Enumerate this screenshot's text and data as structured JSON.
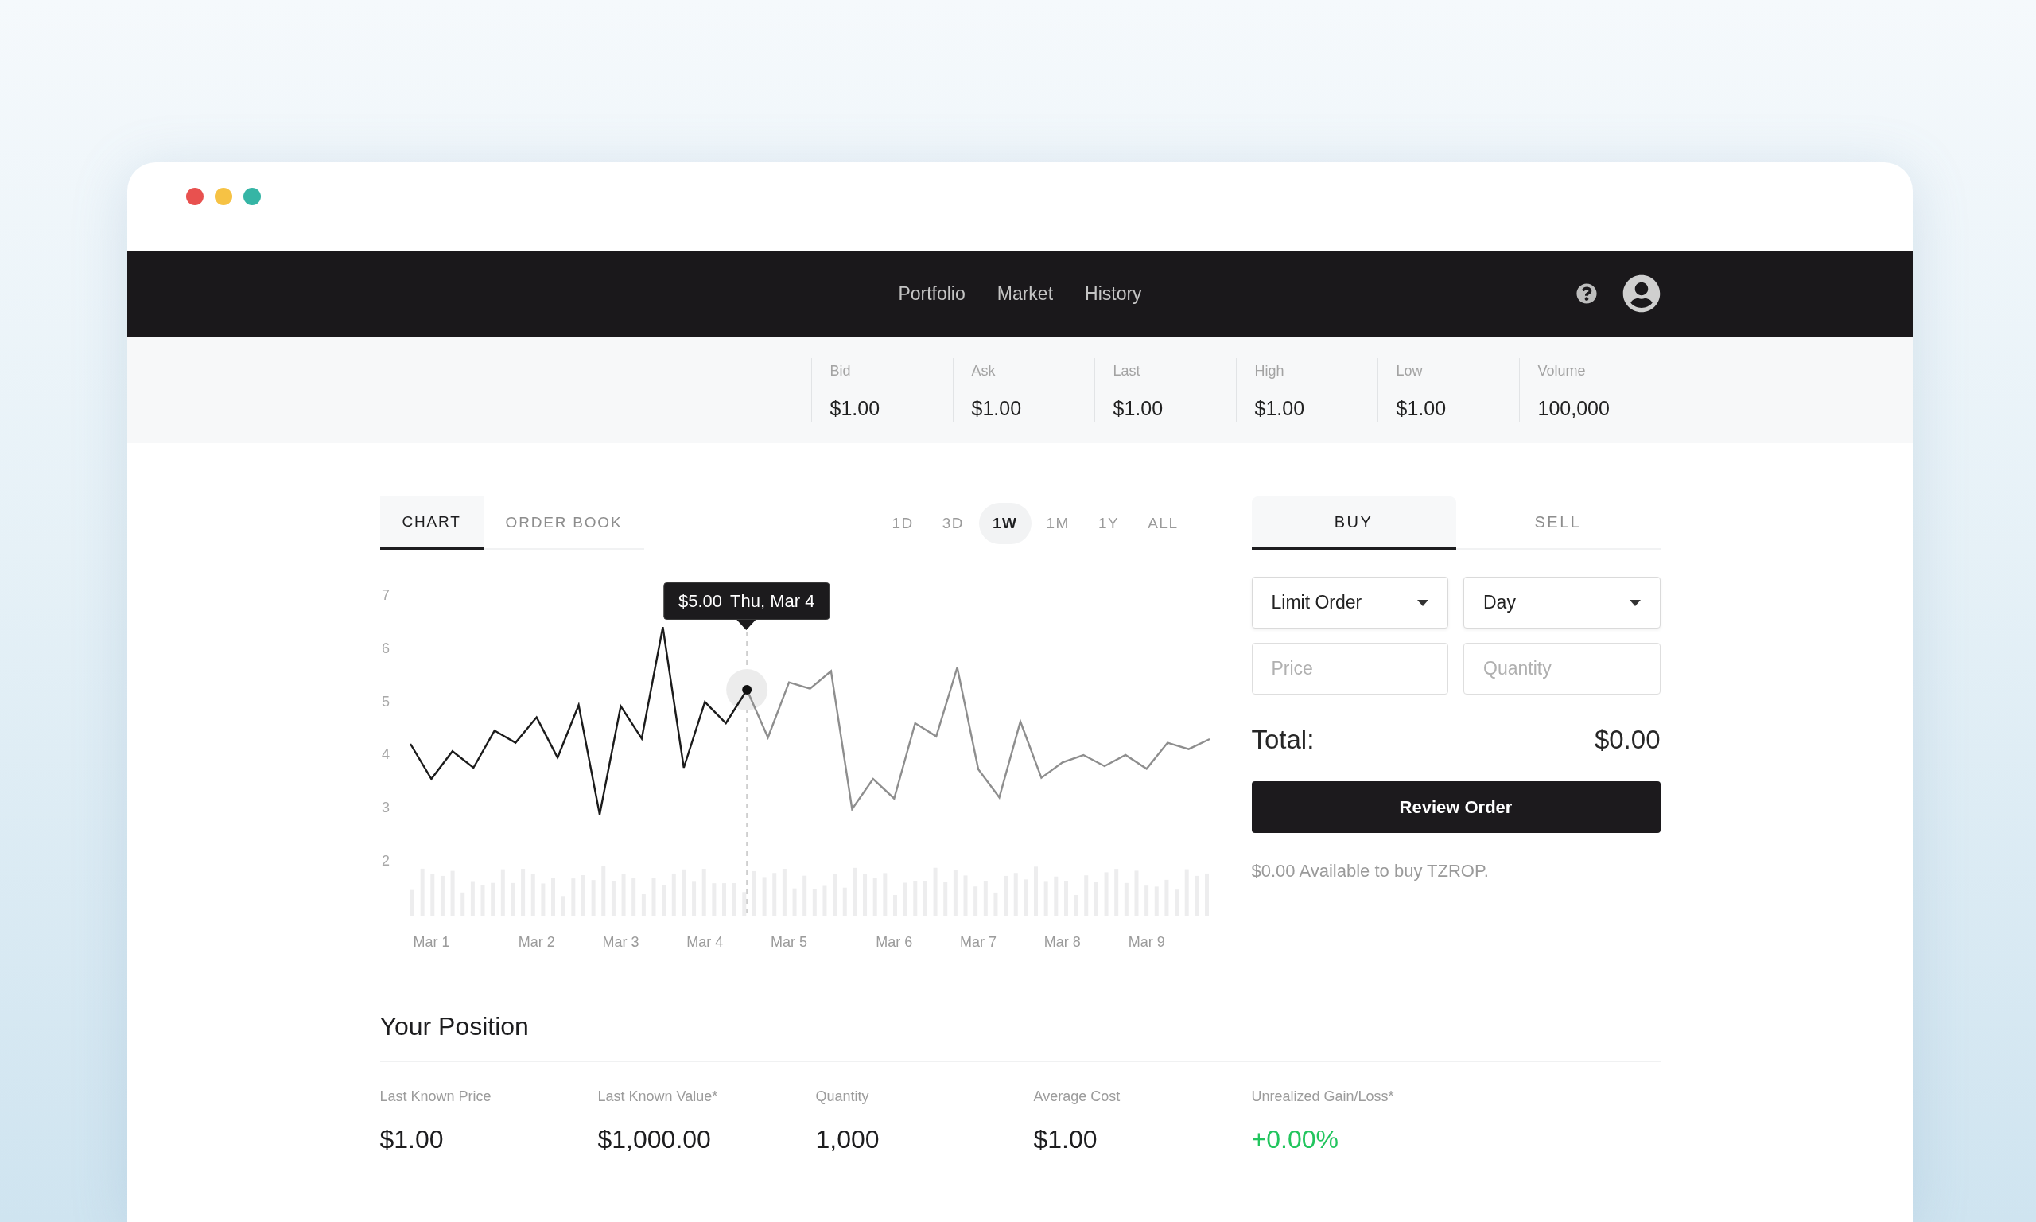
{
  "window": {
    "controls": [
      {
        "color": "#e8514f"
      },
      {
        "color": "#f6c244"
      },
      {
        "color": "#35b5a5"
      }
    ]
  },
  "nav": {
    "links": [
      {
        "label": "Portfolio"
      },
      {
        "label": "Market"
      },
      {
        "label": "History"
      }
    ]
  },
  "quote_stats": [
    {
      "label": "Bid",
      "value": "$1.00"
    },
    {
      "label": "Ask",
      "value": "$1.00"
    },
    {
      "label": "Last",
      "value": "$1.00"
    },
    {
      "label": "High",
      "value": "$1.00"
    },
    {
      "label": "Low",
      "value": "$1.00"
    },
    {
      "label": "Volume",
      "value": "100,000"
    }
  ],
  "chart_panel": {
    "tabs": [
      {
        "label": "CHART",
        "selected": true
      },
      {
        "label": "ORDER BOOK",
        "selected": false
      }
    ],
    "ranges": [
      {
        "label": "1D",
        "selected": false
      },
      {
        "label": "3D",
        "selected": false
      },
      {
        "label": "1W",
        "selected": true
      },
      {
        "label": "1M",
        "selected": false
      },
      {
        "label": "1Y",
        "selected": false
      },
      {
        "label": "ALL",
        "selected": false
      }
    ],
    "tooltip": {
      "value": "$5.00",
      "date": "Thu, Mar 4"
    },
    "chart_data": [
      {
        "type": "line",
        "categories": [
          null,
          "Mar 1",
          null,
          null,
          null,
          null,
          "Mar 2",
          null,
          null,
          null,
          "Mar 3",
          null,
          null,
          null,
          "Mar 4",
          null,
          null,
          null,
          "Mar 5",
          null,
          null,
          null,
          null,
          "Mar 6",
          null,
          null,
          null,
          "Mar 7",
          null,
          null,
          null,
          "Mar 8",
          null,
          null,
          null,
          "Mar 9",
          null,
          null,
          null
        ],
        "ylim": [
          2,
          7
        ],
        "yticks": [
          2,
          3,
          4,
          5,
          6,
          7
        ],
        "series": [
          {
            "color": "#1b1b1b",
            "values": [
              4.22,
              3.56,
              4.08,
              3.77,
              4.47,
              4.24,
              4.72,
              3.96,
              4.95,
              2.89,
              4.93,
              4.32,
              6.42,
              3.77,
              5.01,
              4.61,
              5.24,
              null,
              null,
              null,
              null,
              null,
              null,
              null,
              null,
              null,
              null,
              null,
              null,
              null,
              null,
              null,
              null,
              null,
              null,
              null,
              null,
              null,
              null
            ]
          },
          {
            "color": "#8e8e8e",
            "values": [
              null,
              null,
              null,
              null,
              null,
              null,
              null,
              null,
              null,
              null,
              null,
              null,
              null,
              null,
              null,
              null,
              5.24,
              4.34,
              5.38,
              5.26,
              5.59,
              2.99,
              3.56,
              3.19,
              4.61,
              4.36,
              5.66,
              3.74,
              3.21,
              4.64,
              3.58,
              3.87,
              4.01,
              3.8,
              4.01,
              3.75,
              4.24,
              4.12,
              4.31
            ]
          }
        ]
      }
    ]
  },
  "order_panel": {
    "tabs": [
      {
        "label": "BUY",
        "selected": true
      },
      {
        "label": "SELL",
        "selected": false
      }
    ],
    "selects": [
      {
        "value": "Limit Order"
      },
      {
        "value": "Day"
      }
    ],
    "inputs": [
      {
        "placeholder": "Price"
      },
      {
        "placeholder": "Quantity"
      }
    ],
    "total": {
      "label": "Total:",
      "value": "$0.00"
    },
    "submit": {
      "label": "Review Order"
    },
    "note": "$0.00 Available to buy TZROP."
  },
  "position": {
    "title": "Your Position",
    "items": [
      {
        "label": "Last Known Price",
        "value": "$1.00",
        "kind": "amount"
      },
      {
        "label": "Last Known Value*",
        "value": "$1,000.00",
        "kind": "amount"
      },
      {
        "label": "Quantity",
        "value": "1,000",
        "kind": "amount"
      },
      {
        "label": "Average Cost",
        "value": "$1.00",
        "kind": "amount"
      },
      {
        "label": "Unrealized Gain/Loss*",
        "value": "+0.00%",
        "kind": "change"
      }
    ]
  }
}
